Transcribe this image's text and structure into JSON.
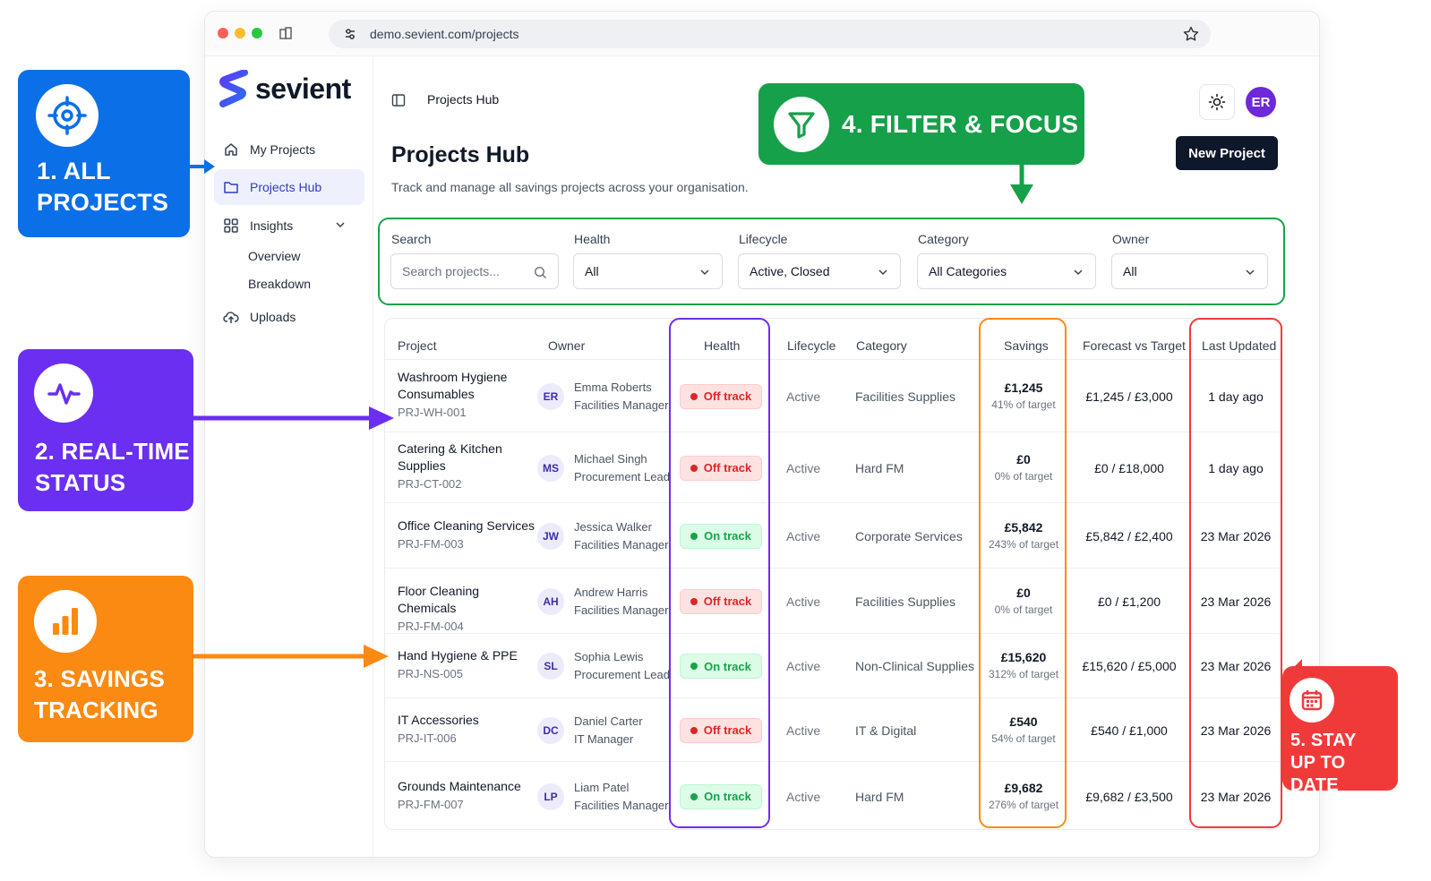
{
  "browser": {
    "url": "demo.sevient.com/projects"
  },
  "sidebar": {
    "brand": "sevient",
    "items": [
      {
        "label": "My Projects"
      },
      {
        "label": "Projects Hub"
      },
      {
        "label": "Insights"
      },
      {
        "label": "Uploads"
      }
    ],
    "insights_sub": [
      "Overview",
      "Breakdown"
    ]
  },
  "topbar": {
    "title": "Projects Hub",
    "avatar": "ER"
  },
  "page": {
    "title": "Projects Hub",
    "subtitle": "Track and manage all savings projects across your organisation.",
    "new_button": "New Project"
  },
  "filters": {
    "search": {
      "label": "Search",
      "placeholder": "Search projects..."
    },
    "health": {
      "label": "Health",
      "value": "All"
    },
    "lifecycle": {
      "label": "Lifecycle",
      "value": "Active, Closed"
    },
    "category": {
      "label": "Category",
      "value": "All Categories"
    },
    "owner": {
      "label": "Owner",
      "value": "All"
    }
  },
  "table": {
    "headers": [
      "Project",
      "Owner",
      "Health",
      "Lifecycle",
      "Category",
      "Savings",
      "Forecast vs Target",
      "Last Updated"
    ],
    "rows": [
      {
        "name": "Washroom Hygiene Consumables",
        "id": "PRJ-WH-001",
        "initials": "ER",
        "owner": "Emma Roberts",
        "role": "Facilities Manager",
        "health": "Off track",
        "lifecycle": "Active",
        "category": "Facilities Supplies",
        "savings": "£1,245",
        "pct": "41% of target",
        "forecast": "£1,245 / £3,000",
        "updated": "1 day ago"
      },
      {
        "name": "Catering & Kitchen Supplies",
        "id": "PRJ-CT-002",
        "initials": "MS",
        "owner": "Michael Singh",
        "role": "Procurement Lead",
        "health": "Off track",
        "lifecycle": "Active",
        "category": "Hard FM",
        "savings": "£0",
        "pct": "0% of target",
        "forecast": "£0 / £18,000",
        "updated": "1 day ago"
      },
      {
        "name": "Office Cleaning Services",
        "id": "PRJ-FM-003",
        "initials": "JW",
        "owner": "Jessica Walker",
        "role": "Facilities Manager",
        "health": "On track",
        "lifecycle": "Active",
        "category": "Corporate Services",
        "savings": "£5,842",
        "pct": "243% of target",
        "forecast": "£5,842 / £2,400",
        "updated": "23 Mar 2026"
      },
      {
        "name": "Floor Cleaning Chemicals",
        "id": "PRJ-FM-004",
        "initials": "AH",
        "owner": "Andrew Harris",
        "role": "Facilities Manager",
        "health": "Off track",
        "lifecycle": "Active",
        "category": "Facilities Supplies",
        "savings": "£0",
        "pct": "0% of target",
        "forecast": "£0 / £1,200",
        "updated": "23 Mar 2026"
      },
      {
        "name": "Hand Hygiene & PPE",
        "id": "PRJ-NS-005",
        "initials": "SL",
        "owner": "Sophia Lewis",
        "role": "Procurement Lead",
        "health": "On track",
        "lifecycle": "Active",
        "category": "Non-Clinical Supplies",
        "savings": "£15,620",
        "pct": "312% of target",
        "forecast": "£15,620 / £5,000",
        "updated": "23 Mar 2026"
      },
      {
        "name": "IT Accessories",
        "id": "PRJ-IT-006",
        "initials": "DC",
        "owner": "Daniel Carter",
        "role": "IT Manager",
        "health": "Off track",
        "lifecycle": "Active",
        "category": "IT & Digital",
        "savings": "£540",
        "pct": "54% of target",
        "forecast": "£540 / £1,000",
        "updated": "23 Mar 2026"
      },
      {
        "name": "Grounds Maintenance",
        "id": "PRJ-FM-007",
        "initials": "LP",
        "owner": "Liam Patel",
        "role": "Facilities Manager",
        "health": "On track",
        "lifecycle": "Active",
        "category": "Hard FM",
        "savings": "£9,682",
        "pct": "276% of target",
        "forecast": "£9,682 / £3,500",
        "updated": "23 Mar 2026"
      }
    ]
  },
  "callouts": {
    "c1": [
      "1. ALL",
      "PROJECTS"
    ],
    "c2": [
      "2. REAL-TIME",
      "STATUS"
    ],
    "c3": [
      "3. SAVINGS",
      "TRACKING"
    ],
    "c4": "4. FILTER & FOCUS",
    "c5": [
      "5. STAY",
      "UP TO DATE"
    ]
  },
  "colors": {
    "blue": "#0b6fe8",
    "purple": "#6a2ff0",
    "orange": "#fb8a12",
    "green": "#16a04a",
    "red": "#f03a3a"
  },
  "icons": [
    "target-icon",
    "pulse-icon",
    "bar-chart-icon",
    "filter-icon",
    "calendar-icon",
    "home-icon",
    "folder-icon",
    "grid-icon",
    "cloud-upload-icon",
    "sun-icon",
    "search-icon",
    "chevron-down-icon",
    "star-icon",
    "panel-icon"
  ]
}
